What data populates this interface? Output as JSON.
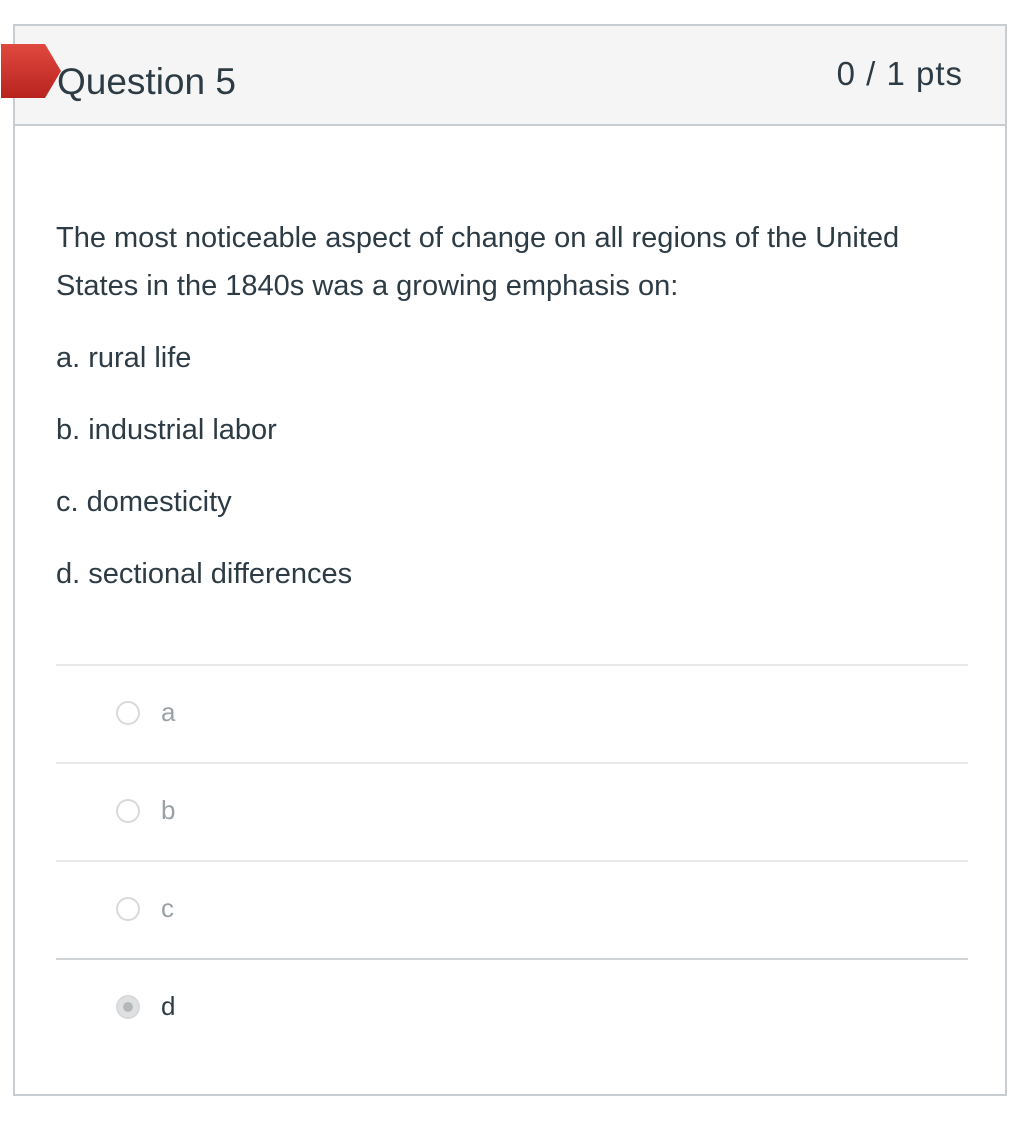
{
  "question": {
    "title": "Question 5",
    "points": "0 / 1 pts",
    "status": "incorrect",
    "flag_color": "#d0302b",
    "text": "The most noticeable aspect of change on all regions of the United States in the 1840s was a growing emphasis on:",
    "options": [
      "a. rural life",
      "b. industrial labor",
      "c. domesticity",
      "d. sectional differences"
    ]
  },
  "answers": [
    {
      "label": "a",
      "selected": false
    },
    {
      "label": "b",
      "selected": false
    },
    {
      "label": "c",
      "selected": false
    },
    {
      "label": "d",
      "selected": true
    }
  ]
}
